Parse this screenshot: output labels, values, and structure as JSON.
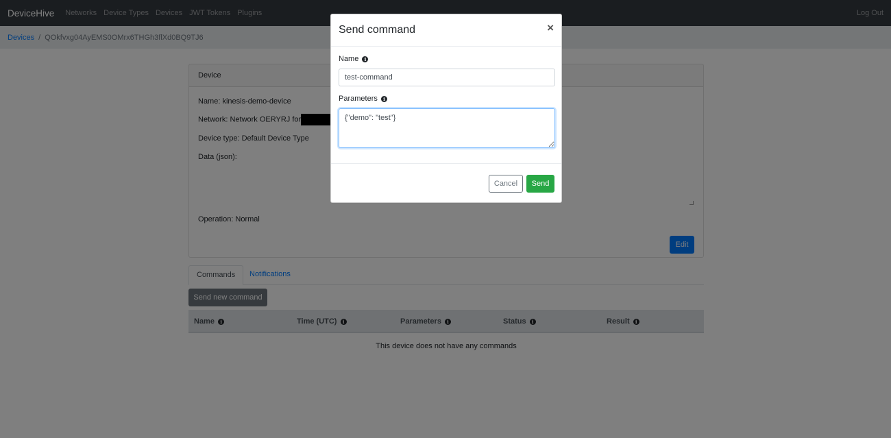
{
  "navbar": {
    "brand": "DeviceHive",
    "links": [
      "Networks",
      "Device Types",
      "Devices",
      "JWT Tokens",
      "Plugins"
    ],
    "logout": "Log Out"
  },
  "breadcrumb": {
    "parent": "Devices",
    "separator": "/",
    "current": "QOkfvxg04AyEMS0OMrx6THGh3flXd0BQ9TJ6"
  },
  "device_card": {
    "header": "Device",
    "name": "Name: kinesis-demo-device",
    "network": "Network: Network OERYRJ for",
    "device_type": "Device type: Default Device Type",
    "data_label": "Data (json):",
    "operation": "Operation: Normal",
    "edit_label": "Edit"
  },
  "tabs": {
    "commands": "Commands",
    "notifications": "Notifications"
  },
  "send_new_command_label": "Send new command",
  "table": {
    "headers": [
      "Name",
      "Time (UTC)",
      "Parameters",
      "Status",
      "Result"
    ],
    "empty_message": "This device does not have any commands"
  },
  "modal": {
    "title": "Send command",
    "close": "×",
    "name_label": "Name",
    "name_value": "test-command",
    "parameters_label": "Parameters",
    "parameters_value": "{\"demo\": \"test\"}",
    "cancel_label": "Cancel",
    "send_label": "Send"
  },
  "colors": {
    "navbar_bg": "#343a40",
    "primary": "#007bff",
    "success": "#28a745",
    "secondary": "#6c757d"
  }
}
